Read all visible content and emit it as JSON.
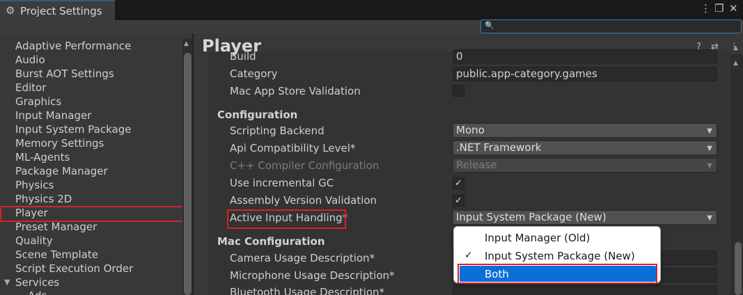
{
  "window": {
    "title": "Project Settings",
    "gear_icon": "⚙",
    "more_icon": "⋮",
    "maximize_icon": "❐",
    "close_icon": "✕"
  },
  "search": {
    "icon": "🔍",
    "value": ""
  },
  "sidebar": {
    "items": [
      {
        "label": "Adaptive Performance"
      },
      {
        "label": "Audio"
      },
      {
        "label": "Burst AOT Settings"
      },
      {
        "label": "Editor"
      },
      {
        "label": "Graphics"
      },
      {
        "label": "Input Manager"
      },
      {
        "label": "Input System Package"
      },
      {
        "label": "Memory Settings"
      },
      {
        "label": "ML-Agents"
      },
      {
        "label": "Package Manager"
      },
      {
        "label": "Physics"
      },
      {
        "label": "Physics 2D"
      },
      {
        "label": "Player"
      },
      {
        "label": "Preset Manager"
      },
      {
        "label": "Quality"
      },
      {
        "label": "Scene Template"
      },
      {
        "label": "Script Execution Order"
      },
      {
        "label": "Services"
      },
      {
        "label": "Ads"
      }
    ],
    "selected": "Player",
    "services_arrow": "▼"
  },
  "header": {
    "title": "Player",
    "help_icon": "?",
    "settings_icon": "⇄",
    "more_icon": "⋮"
  },
  "fields": {
    "build_label": "Build",
    "build_value": "0",
    "category_label": "Category",
    "category_value": "public.app-category.games",
    "mac_validation_label": "Mac App Store Validation",
    "configuration_header": "Configuration",
    "scripting_backend_label": "Scripting Backend",
    "scripting_backend_value": "Mono",
    "api_level_label": "Api Compatibility Level*",
    "api_level_value": ".NET Framework",
    "cpp_config_label": "C++ Compiler Configuration",
    "cpp_config_value": "Release",
    "incremental_gc_label": "Use incremental GC",
    "assembly_validation_label": "Assembly Version Validation",
    "active_input_label": "Active Input Handling*",
    "active_input_value": "Input System Package (New)",
    "mac_config_header": "Mac Configuration",
    "camera_usage_label": "Camera Usage Description*",
    "microphone_usage_label": "Microphone Usage Description*",
    "bluetooth_usage_label": "Bluetooth Usage Description*",
    "check_mark": "✓",
    "caret": "▼"
  },
  "popup": {
    "options": [
      "Input Manager (Old)",
      "Input System Package (New)",
      "Both"
    ],
    "checked": "Input System Package (New)",
    "highlighted": "Both",
    "check_mark": "✓"
  },
  "colors": {
    "highlight_red": "#d8212a",
    "selection_blue": "#0a70d6",
    "search_border": "#3a79bb"
  }
}
